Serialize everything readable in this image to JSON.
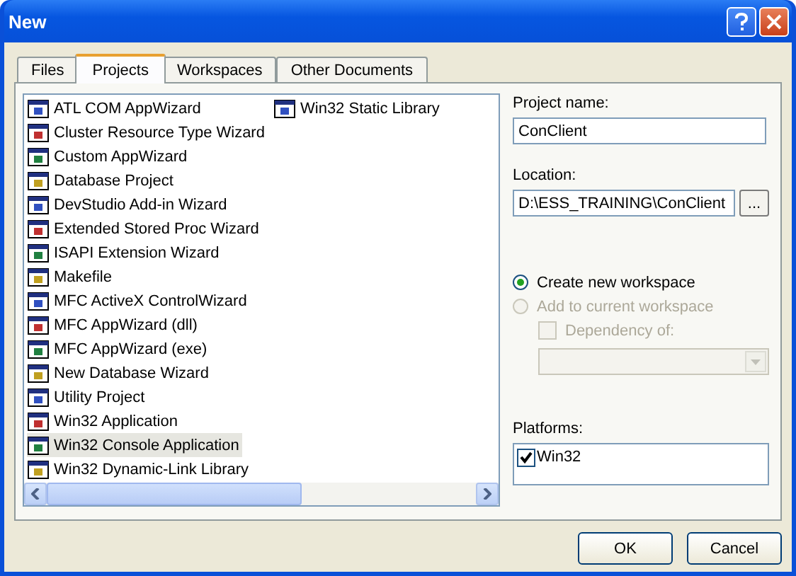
{
  "window": {
    "title": "New"
  },
  "tabs": [
    {
      "label": "Files",
      "selected": false
    },
    {
      "label": "Projects",
      "selected": true
    },
    {
      "label": "Workspaces",
      "selected": false
    },
    {
      "label": "Other Documents",
      "selected": false
    }
  ],
  "project_types": [
    {
      "label": "ATL COM AppWizard",
      "selected": false
    },
    {
      "label": "Cluster Resource Type Wizard",
      "selected": false
    },
    {
      "label": "Custom AppWizard",
      "selected": false
    },
    {
      "label": "Database Project",
      "selected": false
    },
    {
      "label": "DevStudio Add-in Wizard",
      "selected": false
    },
    {
      "label": "Extended Stored Proc Wizard",
      "selected": false
    },
    {
      "label": "ISAPI Extension Wizard",
      "selected": false
    },
    {
      "label": "Makefile",
      "selected": false
    },
    {
      "label": "MFC ActiveX ControlWizard",
      "selected": false
    },
    {
      "label": "MFC AppWizard (dll)",
      "selected": false
    },
    {
      "label": "MFC AppWizard (exe)",
      "selected": false
    },
    {
      "label": "New Database Wizard",
      "selected": false
    },
    {
      "label": "Utility Project",
      "selected": false
    },
    {
      "label": "Win32 Application",
      "selected": false
    },
    {
      "label": "Win32 Console Application",
      "selected": true
    },
    {
      "label": "Win32 Dynamic-Link Library",
      "selected": false
    },
    {
      "label": "Win32 Static Library",
      "selected": false
    }
  ],
  "project_name": {
    "label": "Project name:",
    "value": "ConClient"
  },
  "location": {
    "label": "Location:",
    "value": "D:\\ESS_TRAINING\\ConClient",
    "browse_button": "..."
  },
  "workspace_options": [
    {
      "label": "Create new workspace",
      "selected": true,
      "disabled": false
    },
    {
      "label": "Add to current workspace",
      "selected": false,
      "disabled": true
    }
  ],
  "dependency": {
    "label": "Dependency of:",
    "checked": false,
    "disabled": true
  },
  "platforms": {
    "label": "Platforms:",
    "items": [
      {
        "label": "Win32",
        "checked": true
      }
    ]
  },
  "buttons": [
    "OK",
    "Cancel"
  ]
}
